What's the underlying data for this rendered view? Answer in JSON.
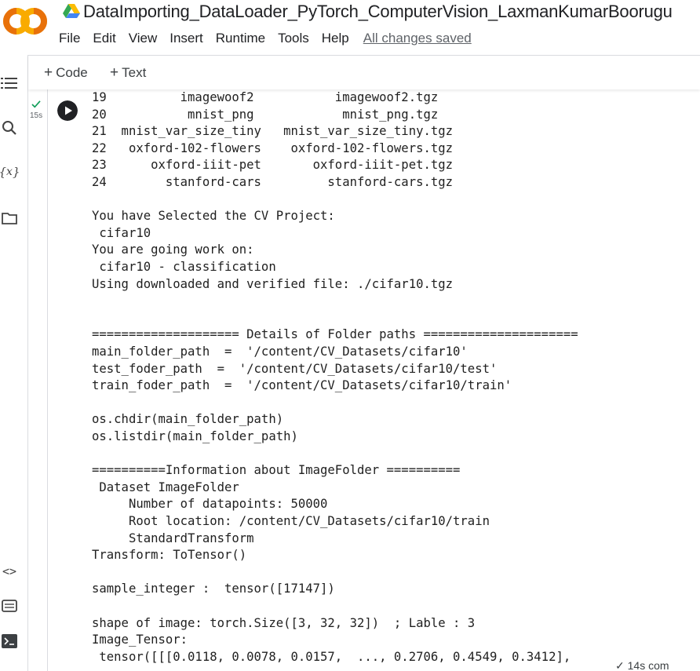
{
  "header": {
    "title": "DataImporting_DataLoader_PyTorch_ComputerVision_LaxmanKumarBoorugu",
    "logo_text": "CO",
    "menu": [
      "File",
      "Edit",
      "View",
      "Insert",
      "Runtime",
      "Tools",
      "Help"
    ],
    "save_status": "All changes saved"
  },
  "toolbar": {
    "code_label": "Code",
    "text_label": "Text"
  },
  "cell": {
    "exec_time": "15s"
  },
  "output_lines": [
    "19          imagewoof2           imagewoof2.tgz",
    "20           mnist_png            mnist_png.tgz",
    "21  mnist_var_size_tiny   mnist_var_size_tiny.tgz",
    "22   oxford-102-flowers    oxford-102-flowers.tgz",
    "23      oxford-iiit-pet       oxford-iiit-pet.tgz",
    "24        stanford-cars         stanford-cars.tgz",
    "",
    "You have Selected the CV Project:",
    " cifar10",
    "You are going work on:",
    " cifar10 - classification",
    "Using downloaded and verified file: ./cifar10.tgz",
    "",
    "",
    "==================== Details of Folder paths =====================",
    "main_folder_path  =  '/content/CV_Datasets/cifar10'",
    "test_foder_path  =  '/content/CV_Datasets/cifar10/test'",
    "train_foder_path  =  '/content/CV_Datasets/cifar10/train'",
    "",
    "os.chdir(main_folder_path)",
    "os.listdir(main_folder_path)",
    "",
    "==========Information about ImageFolder ==========",
    " Dataset ImageFolder",
    "     Number of datapoints: 50000",
    "     Root location: /content/CV_Datasets/cifar10/train",
    "     StandardTransform",
    "Transform: ToTensor()",
    "",
    "sample_integer :  tensor([17147])",
    "",
    "shape of image: torch.Size([3, 32, 32])  ; Lable : 3",
    "Image_Tensor:",
    " tensor([[[0.0118, 0.0078, 0.0157,  ..., 0.2706, 0.4549, 0.3412],"
  ],
  "status_bar": {
    "text": "✓ 14s   com"
  },
  "colors": {
    "logo_orange": "#f9ab00",
    "logo_dark_orange": "#e8710a",
    "success_green": "#0f9d58",
    "run_button": "#202124"
  }
}
